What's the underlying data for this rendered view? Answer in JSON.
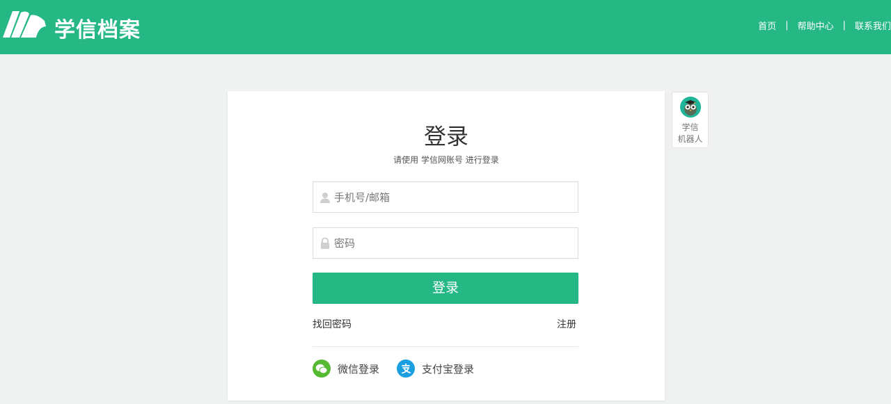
{
  "header": {
    "logo_text": "学信档案",
    "nav": [
      {
        "label": "首页"
      },
      {
        "label": "帮助中心"
      },
      {
        "label": "联系我们"
      }
    ],
    "separator": "|",
    "brand_color": "#25b884"
  },
  "login": {
    "title": "登录",
    "subtitle": "请使用 学信网账号 进行登录",
    "username": {
      "placeholder": "手机号/邮箱",
      "value": "",
      "icon": "user-icon"
    },
    "password": {
      "placeholder": "密码",
      "value": "",
      "icon": "lock-icon"
    },
    "submit_label": "登录",
    "forgot_label": "找回密码",
    "register_label": "注册",
    "social": [
      {
        "label": "微信登录",
        "icon": "wechat-icon",
        "color": "#55b932"
      },
      {
        "label": "支付宝登录",
        "icon": "alipay-icon",
        "color": "#1c9fe0"
      }
    ]
  },
  "robot": {
    "label_line1": "学信",
    "label_line2": "机器人",
    "icon": "owl-robot-icon"
  }
}
